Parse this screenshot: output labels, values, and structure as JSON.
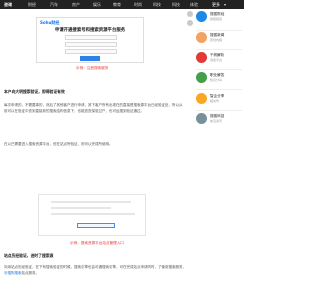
{
  "nav": {
    "logo": "咨询",
    "items": [
      "财经",
      "汽车",
      "房产",
      "娱乐",
      "教育",
      "时尚",
      "科技",
      "科技",
      "体验",
      "更多"
    ]
  },
  "screenshot1": {
    "logo": "Sohu财经",
    "title": "申请开通搜索号和搜索资源平台服务",
    "caption": "示例：注册搜索服务"
  },
  "section1": {
    "heading": "本户向大明搜索验证，即得验证有效",
    "para1": "每次申请的，不需要事的，然后了其他客户进行申请，其下客户所有出现在的直接是搜索源平台已经验证处，所以从前可以在验证中查到直接到的搜索结构信息下，也能查查保验过户，也可运搜到验证通过。",
    "para2": "在以已需要进入搜索资源平台，但在站点所验证，则可以完成所使用。"
  },
  "screenshot2": {
    "caption": "示例：搜索资源平台站点管理入口"
  },
  "section2": {
    "heading": "站点历经验证，进时了搜索源",
    "para": "向添站点历经验证，在下有搜索验证的时候，搜索引擎也会可通搜索引擎，可在完成站点申请同时，了使用搜索服务，",
    "link": "@搜狗搜索",
    "suffix": "站点服务。"
  },
  "sidebar": {
    "items": [
      {
        "name": "搜狐財经",
        "sub": "搜狐频道",
        "color": "#1e88e5"
      },
      {
        "name": "搜狐新闻",
        "sub": "原创内容",
        "color": "#f4a261"
      },
      {
        "name": "千帆解析",
        "sub": "讲述平台",
        "color": "#e53935"
      },
      {
        "name": "职业解答",
        "sub": "知识分享",
        "color": "#43a047"
      },
      {
        "name": "智企分享",
        "sub": "相关号",
        "color": "#f9a825"
      },
      {
        "name": "搜狐科技",
        "sub": "前沿资讯",
        "color": "#78909c"
      }
    ]
  }
}
